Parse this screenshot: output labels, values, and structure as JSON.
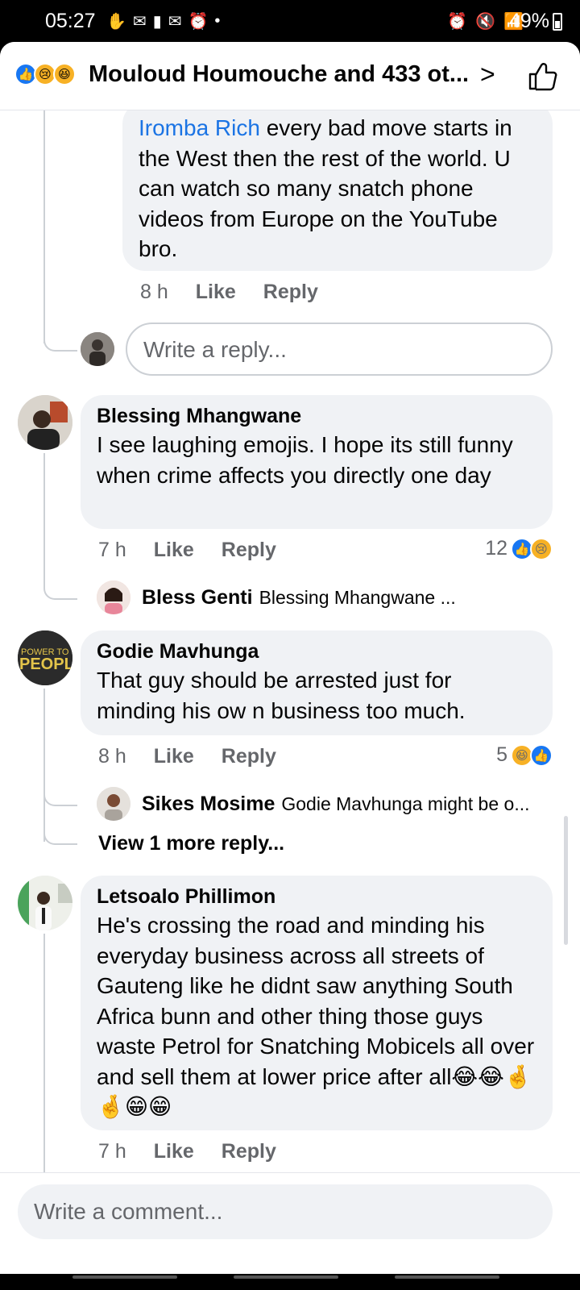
{
  "status": {
    "time": "05:27",
    "battery": "49%"
  },
  "header": {
    "title": "Mouloud Houmouche and 433 ot..."
  },
  "comments": [
    {
      "mention": "Iromba Rich",
      "text": " every bad move starts in the West then the rest of the world. U can watch so many snatch phone videos from Europe on the YouTube bro.",
      "time": "8 h",
      "like": "Like",
      "reply": "Reply"
    },
    {
      "author": "Blessing Mhangwane",
      "text": "I see laughing emojis.  I hope its still funny when crime affects you directly one day",
      "time": "7 h",
      "like": "Like",
      "reply": "Reply",
      "reaction_count": "12",
      "reply_preview": {
        "name": "Bless Genti",
        "snippet": "Blessing Mhangwane ..."
      }
    },
    {
      "author": "Godie Mavhunga",
      "text": "That guy should be arrested just for minding his ow n business too much.",
      "time": "8 h",
      "like": "Like",
      "reply": "Reply",
      "reaction_count": "5",
      "reply_preview": {
        "name": "Sikes Mosime",
        "snippet": "Godie Mavhunga might be o..."
      },
      "view_more": "View 1 more reply..."
    },
    {
      "author": "Letsoalo Phillimon",
      "text": "He's crossing the road and minding his everyday business across all streets of Gauteng like he didnt saw anything South Africa bunn and other thing those guys waste Petrol for Snatching Mobicels all over and sell them at lower price after all😂😂🤞🤞😁😁",
      "time": "7 h",
      "like": "Like",
      "reply": "Reply"
    }
  ],
  "reply_input": {
    "placeholder": "Write a reply..."
  },
  "composer": {
    "placeholder": "Write a comment..."
  },
  "colors": {
    "accent": "#1877f2",
    "mention": "#1b74e4",
    "bubble": "#f0f2f5",
    "muted": "#65676b"
  },
  "icons": [
    "like-reaction-icon",
    "sad-reaction-icon",
    "haha-reaction-icon",
    "chevron-right-icon",
    "thumbs-up-icon"
  ]
}
